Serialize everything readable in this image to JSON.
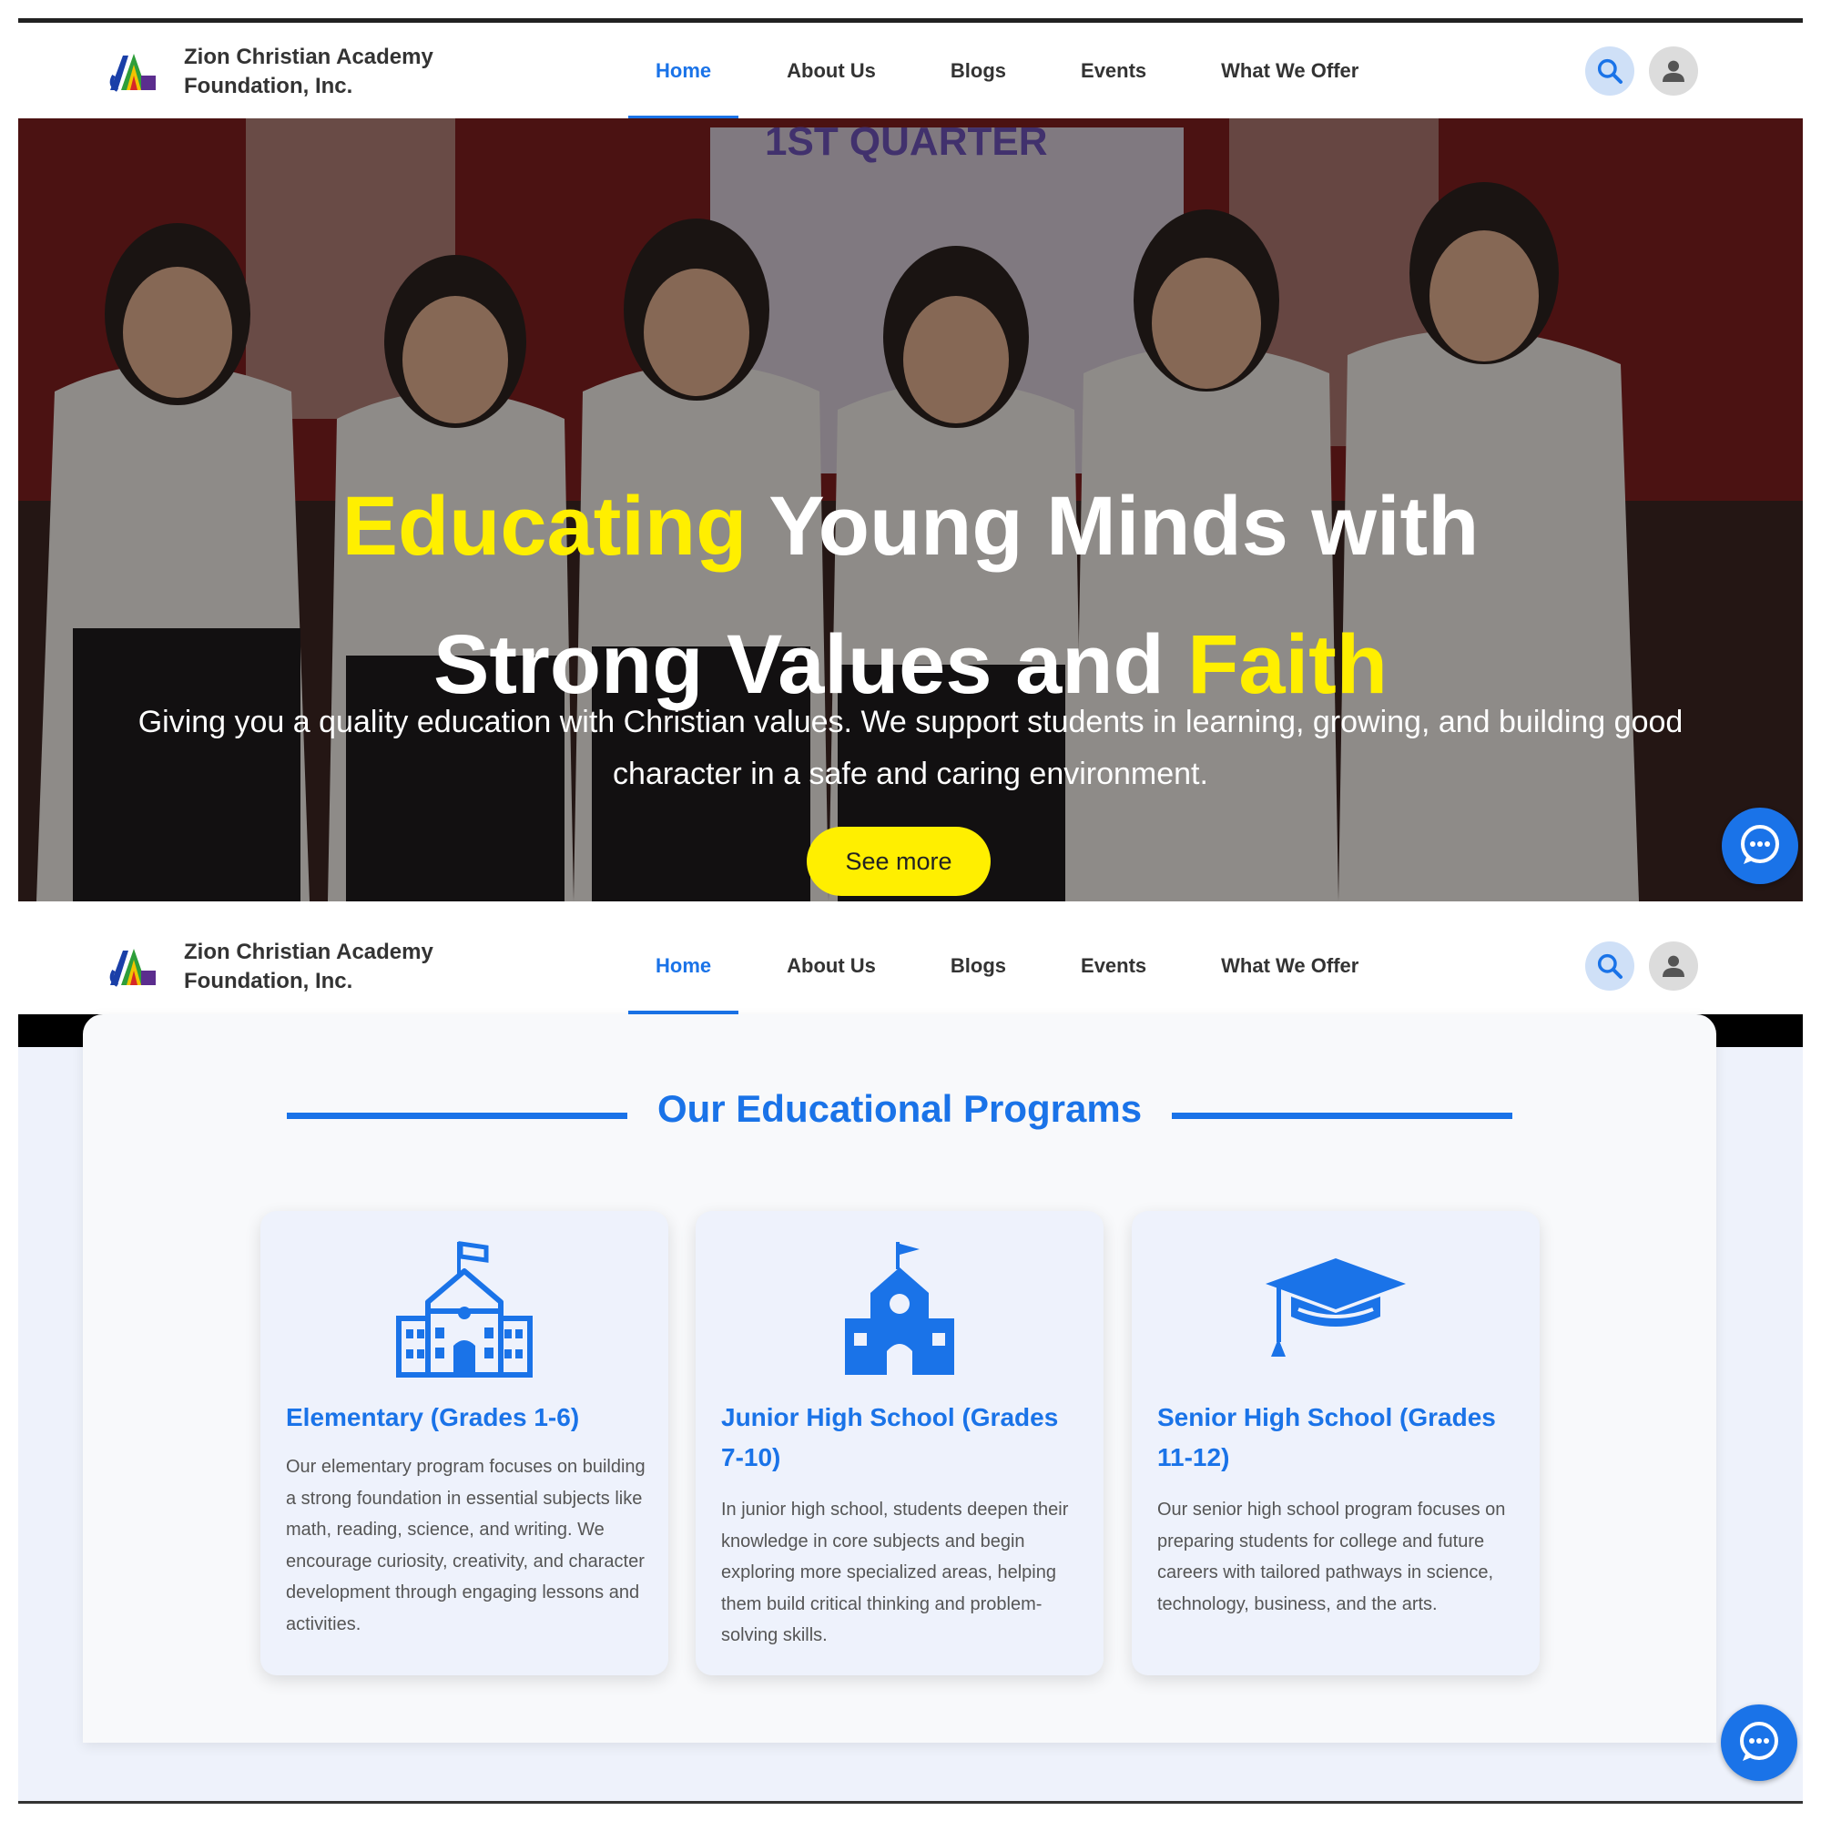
{
  "nav": {
    "brand_line1": "Zion Christian Academy",
    "brand_line2": "Foundation, Inc.",
    "items": [
      {
        "label": "Home",
        "active": true
      },
      {
        "label": "About Us",
        "active": false
      },
      {
        "label": "Blogs",
        "active": false
      },
      {
        "label": "Events",
        "active": false
      },
      {
        "label": "What We Offer",
        "active": false
      }
    ],
    "search_icon": "search-icon",
    "user_icon": "user-icon"
  },
  "hero": {
    "title_part1": "Educating",
    "title_part2": " Young Minds with",
    "title_part3": "Strong Values and ",
    "title_part4": "Faith",
    "subtitle": "Giving you a quality education with Christian values. We support students in learning, growing, and building good character in a safe and caring environment.",
    "cta_label": "See more",
    "banner_text": "1ST QUARTER"
  },
  "programs": {
    "title": "Our Educational Programs",
    "items": [
      {
        "title": "Elementary (Grades 1-6)",
        "description": "Our elementary program focuses on building a strong foundation in essential subjects like math, reading, science, and writing. We encourage curiosity, creativity, and character development through engaging lessons and activities.",
        "icon": "school-building-icon"
      },
      {
        "title": "Junior High School (Grades 7-10)",
        "description": "In junior high school, students deepen their knowledge in core subjects and begin exploring more specialized areas, helping them build critical thinking and problem-solving skills.",
        "icon": "schoolhouse-icon"
      },
      {
        "title": "Senior High School (Grades 11-12)",
        "description": "Our senior high school program focuses on preparing students for college and future careers with tailored pathways in science, technology, business, and the arts.",
        "icon": "graduation-cap-icon"
      }
    ]
  },
  "colors": {
    "accent": "#1a73e8",
    "highlight": "#ffef00"
  }
}
